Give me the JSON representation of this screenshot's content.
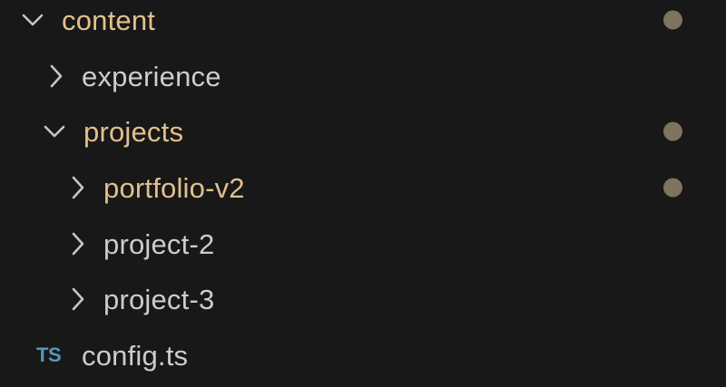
{
  "colors": {
    "background": "#181818",
    "modified_text": "#e2c08d",
    "normal_text": "#cccccc",
    "chevron": "#c5c5c5",
    "dot": "#7d735f",
    "ts_icon": "#519aba"
  },
  "tree": {
    "content": {
      "label": "content",
      "state": "expanded",
      "modified": true
    },
    "experience": {
      "label": "experience",
      "state": "collapsed",
      "modified": false
    },
    "projects": {
      "label": "projects",
      "state": "expanded",
      "modified": true
    },
    "portfolio_v2": {
      "label": "portfolio-v2",
      "state": "collapsed",
      "modified": true
    },
    "project_2": {
      "label": "project-2",
      "state": "collapsed",
      "modified": false
    },
    "project_3": {
      "label": "project-3",
      "state": "collapsed",
      "modified": false
    },
    "config_ts": {
      "label": "config.ts",
      "icon_text": "TS",
      "icon": "typescript-file-icon"
    }
  }
}
